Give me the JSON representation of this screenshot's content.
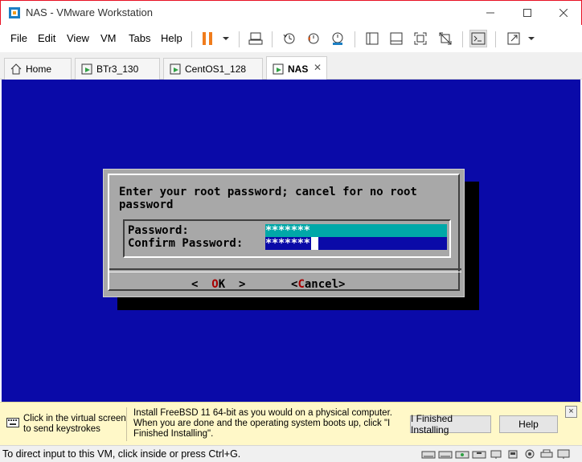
{
  "window": {
    "title": "NAS - VMware Workstation",
    "controls": [
      "minimize",
      "maximize",
      "close"
    ]
  },
  "menu": {
    "items": [
      "File",
      "Edit",
      "View",
      "VM",
      "Tabs",
      "Help"
    ]
  },
  "toolbar": {
    "icons": [
      "pause-icon",
      "dropdown-icon",
      "send-keys-icon",
      "snapshot-icon",
      "revert-snapshot-icon",
      "snapshot-manager-icon",
      "show-library-icon",
      "thumbnail-bar-icon",
      "full-screen-icon",
      "unity-icon",
      "console-view-icon",
      "stretch-guest-icon",
      "dropdown-icon"
    ]
  },
  "tabs": [
    {
      "label": "Home",
      "icon": "home-icon",
      "active": false
    },
    {
      "label": "BTr3_130",
      "icon": "vm-icon",
      "active": false
    },
    {
      "label": "CentOS1_128",
      "icon": "vm-icon",
      "active": false
    },
    {
      "label": "NAS",
      "icon": "vm-icon",
      "active": true,
      "close": "✕"
    }
  ],
  "console": {
    "prompt": "Enter your root password; cancel for no root\npassword",
    "password_label": "Password:",
    "confirm_label": "Confirm Password:",
    "password_value": "*******",
    "confirm_value": "*******",
    "ok_left": "<",
    "ok_hot": "O",
    "ok_rest": "K",
    "ok_right": ">",
    "cancel_left": "<",
    "cancel_hot": "C",
    "cancel_rest": "ancel>",
    "background_color": "#0a0aa8",
    "dialog_color": "#a8a8a8",
    "field_active_color": "#00a8a8"
  },
  "hint": {
    "click_text": "Click in the virtual screen to send keystrokes",
    "message": "Install FreeBSD 11 64-bit as you would on a physical computer. When you are done and the operating system boots up, click \"I Finished Installing\".",
    "finished_button": "I Finished Installing",
    "help_button": "Help",
    "close": "×"
  },
  "status": {
    "text": "To direct input to this VM, click inside or press Ctrl+G.",
    "device_icons": [
      "hard-disk-icon",
      "hard-disk-icon",
      "cd-rom-icon",
      "floppy-icon",
      "network-icon",
      "usb-icon",
      "sound-icon",
      "printer-icon",
      "display-icon",
      "settings-icon"
    ]
  }
}
